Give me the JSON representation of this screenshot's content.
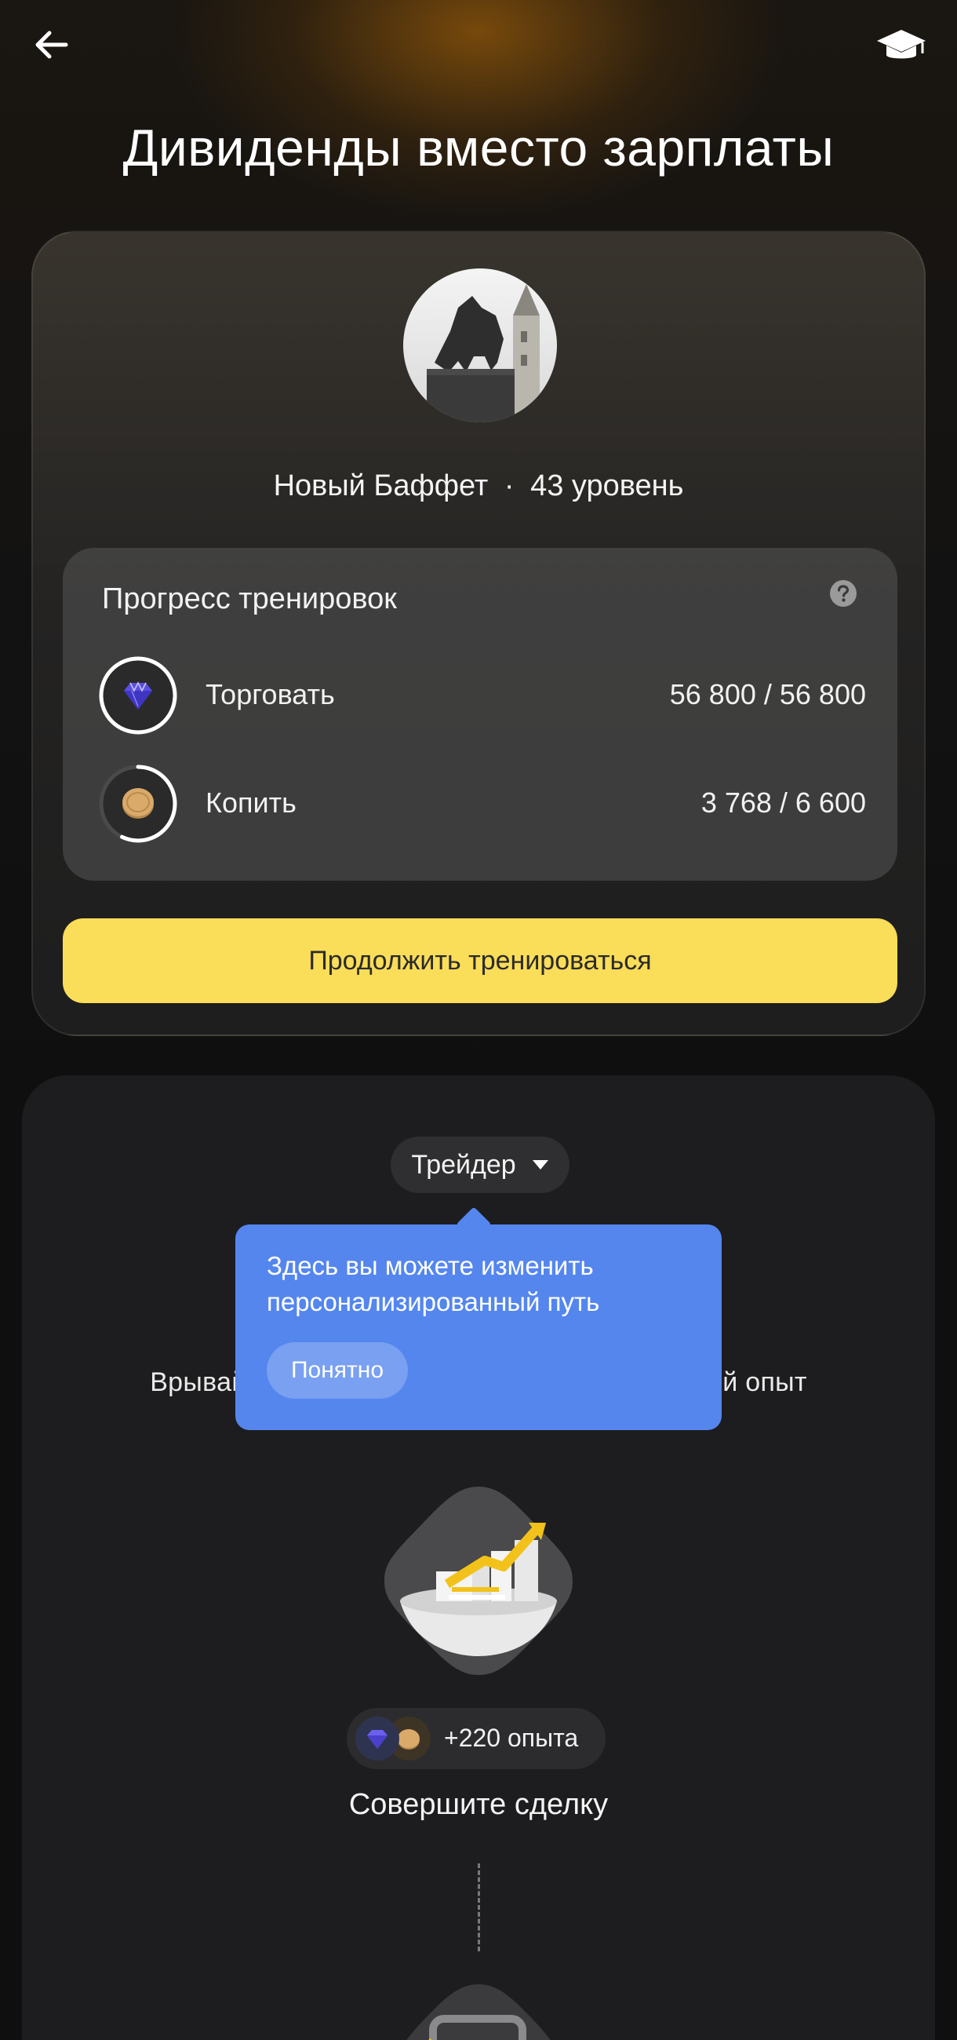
{
  "header": {
    "title": "Дивиденды вместо зарплаты",
    "back_icon": "arrow-left-icon",
    "right_icon": "graduation-cap-icon"
  },
  "profile": {
    "name": "Новый Баффет",
    "separator": "·",
    "level": "43 уровень"
  },
  "progress": {
    "title": "Прогресс тренировок",
    "help_icon": "question-icon",
    "rows": [
      {
        "icon": "diamond-icon",
        "label": "Торговать",
        "value": "56 800 / 56 800",
        "fraction": 1.0
      },
      {
        "icon": "coin-icon",
        "label": "Копить",
        "value": "3 768 / 6 600",
        "fraction": 0.571
      }
    ]
  },
  "continue_button": {
    "label": "Продолжить тренироваться"
  },
  "path": {
    "role_selector": "Трейдер",
    "background_text": "Врывайтесь в трейдинг и получайте реальный опыт",
    "tooltip": {
      "text": "Здесь вы можете изменить персонализированный путь",
      "button": "Понятно"
    },
    "task": {
      "xp": "+220 опыта",
      "title": "Совершите сделку"
    }
  },
  "colors": {
    "accent_yellow": "#fadd58",
    "tooltip_blue": "#5486ee",
    "background": "#0f0f10"
  }
}
